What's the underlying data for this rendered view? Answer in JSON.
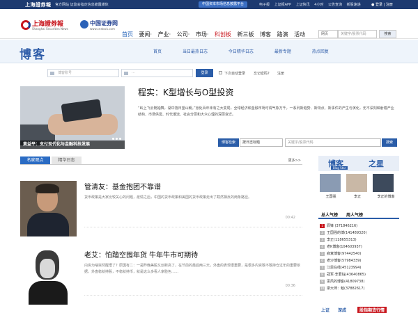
{
  "topbar": {
    "logo": "上海證券報",
    "tagline": "官方网站 证监会指定信息披露媒体",
    "badge": "中国资本市场信息披露平台",
    "links": [
      "电子报",
      "上证报APP",
      "上证快讯",
      "4小时",
      "公告查询",
      "新股速递"
    ],
    "login": "登录",
    "register": "注册"
  },
  "header": {
    "brand_cn": "上海證券報",
    "brand_en": "Shanghai Securities News",
    "brand2_cn": "中国证券网",
    "brand2_en": "www.cnstock.com",
    "nav": [
      "首页",
      "要闻·",
      "产业·",
      "公司·",
      "市场·",
      "科创板",
      "新三板",
      "博客",
      "路演",
      "活动"
    ],
    "search_select": "网页",
    "search_placeholder": "关键字/股票代码",
    "search_button": "搜索"
  },
  "blogbar": {
    "title": "博客",
    "nav": [
      "首页",
      "当日最热日志",
      "今日精华日志",
      "最新专题",
      "热点回复"
    ]
  },
  "login": {
    "account_placeholder": "博客账号",
    "password_placeholder": "···",
    "button": "登录",
    "auto_login": "下次自动登录",
    "forgot": "忘记密码?",
    "register": "注册"
  },
  "feature": {
    "caption": "黄益平：支付现代化与金融科技发展",
    "title": "程实：K型增长与O型投资",
    "desc": "“岭上飞云随袖舞，湖中落日望山朝。”身处百年未有之大变局，全球经济和金融市场可谓气象万千，一系列新趋势、新特点、新事件的产生与演化，无不深刻映射着产业结构、市场供需、时代潮流、社会分层和大众心理的深层变迁。"
  },
  "blogsearch": {
    "label": "博客检索",
    "select": "按日志标题",
    "placeholder": "关键字/股票代码",
    "button": "搜索"
  },
  "tabs": {
    "active": "名家观点",
    "inactive": "精华日志",
    "more": "更多>>"
  },
  "articles": [
    {
      "title": "管清友：基金抱团不靠谱",
      "summary": "货币政策是大家比较关心的问题，疫情之后，中国的货币政策和美国的货币政策走出了截然相反的两条路径。",
      "time": "00:42"
    },
    {
      "title": "老艾：怕踏空囤年货 牛年牛市可期待",
      "summary": "内资为啥突然醒悟了？原因有二：一是昨晚美股又创新高了，在节前的最后两三天，外盘的表现很重要，是很多内资敢不敢持仓过年的重要依据，外盘稳就持股，不稳就持币，就是这么多看人家脸色……",
      "time": "00:36"
    }
  ],
  "sidebar": {
    "blogstar_a": "博客",
    "blogstar_b": "之星",
    "blogstar_sub": "Blog Star",
    "stars": [
      "王国强",
      "李正",
      "李正的博客"
    ],
    "rank_tab1": "总人气榜",
    "rank_tab2": "周人气榜",
    "rank": [
      {
        "n": "1",
        "name": "辰锋 (371846216)"
      },
      {
        "n": "2",
        "name": "王国强的博(141489320)"
      },
      {
        "n": "3",
        "name": "李正(118655313)"
      },
      {
        "n": "4",
        "name": "老K博客(104603937)"
      },
      {
        "n": "5",
        "name": "寂寞博客(97442540)"
      },
      {
        "n": "6",
        "name": "老沙博客(57984339)"
      },
      {
        "n": "7",
        "name": "江恩在线(45123994)"
      },
      {
        "n": "8",
        "name": "冠军·李君钰(43640865)"
      },
      {
        "n": "9",
        "name": "思风的博客(41809738)"
      },
      {
        "n": "10",
        "name": "梁大师：勉(37882617)"
      }
    ],
    "bottom": [
      "上证",
      "深成",
      "股指期货行情"
    ]
  },
  "colors": {
    "navy": "#1d3a70",
    "brand_red": "#c8161d",
    "accent_blue": "#2b5da8"
  }
}
